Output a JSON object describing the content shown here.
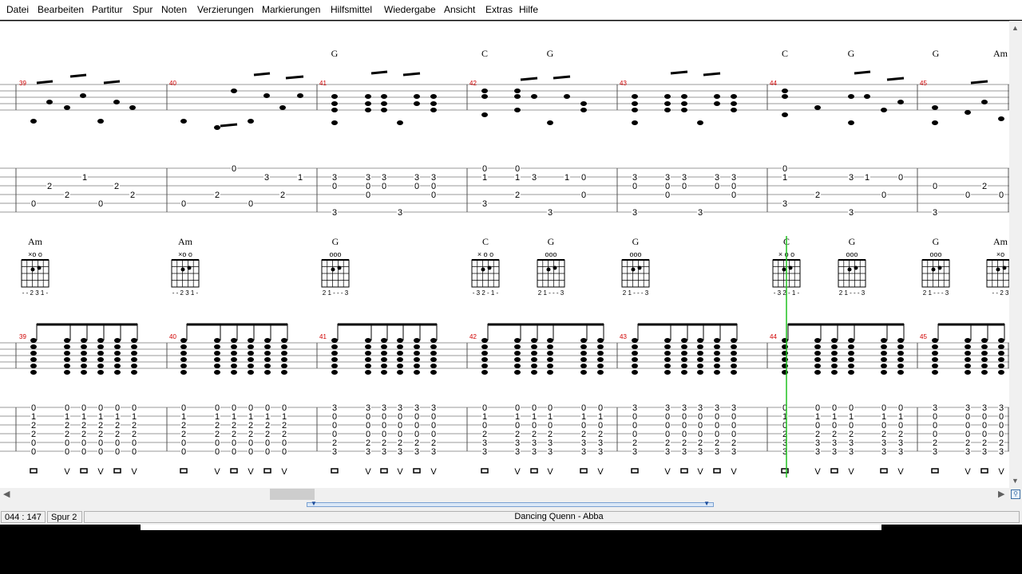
{
  "menu": [
    "Datei",
    "Bearbeiten",
    "Partitur",
    "Spur",
    "Noten",
    "Verzierungen",
    "Markierungen",
    "Hilfsmittel",
    "Wiedergabe",
    "Ansicht",
    "Extras",
    "Hilfe"
  ],
  "score": {
    "chords_top": [
      {
        "name": "G"
      },
      {
        "name": "C"
      },
      {
        "name": "G"
      },
      {
        "name": "C"
      },
      {
        "name": "G"
      },
      {
        "name": "G"
      },
      {
        "name": "Am"
      }
    ],
    "chord_diagrams": [
      {
        "name": "Am",
        "top": "×o   o",
        "fingering": "- - 2 3 1 -"
      },
      {
        "name": "Am",
        "top": "×o   o",
        "fingering": "- - 2 3 1 -"
      },
      {
        "name": "G",
        "top": "ooo",
        "fingering": "2 1 - - - 3"
      },
      {
        "name": "C",
        "top": "×  o o",
        "fingering": "- 3 2 - 1 -"
      },
      {
        "name": "G",
        "top": "ooo",
        "fingering": "2 1 - - - 3"
      },
      {
        "name": "G",
        "top": "ooo",
        "fingering": "2 1 - - - 3"
      },
      {
        "name": "C",
        "top": "×  o o",
        "fingering": "- 3 2 - 1 -"
      },
      {
        "name": "G",
        "top": "ooo",
        "fingering": "2 1 - - - 3"
      },
      {
        "name": "G",
        "top": "ooo",
        "fingering": "2 1 - - - 3"
      },
      {
        "name": "Am",
        "top": "×o",
        "fingering": "- - 2 3"
      }
    ],
    "measure_numbers": [
      "39",
      "40",
      "41",
      "42",
      "43",
      "44",
      "45"
    ],
    "tab1": [
      {
        "n": [
          [
            "0",
            42,
            5
          ],
          [
            "2",
            62,
            3
          ],
          [
            "2",
            84,
            4
          ],
          [
            "1",
            106,
            2
          ],
          [
            "0",
            126,
            5
          ],
          [
            "2",
            146,
            3
          ],
          [
            "2",
            166,
            4
          ]
        ]
      },
      {
        "n": [
          [
            "0",
            230,
            5
          ],
          [
            "2",
            272,
            4
          ],
          [
            "0",
            293,
            1
          ],
          [
            "0",
            314,
            5
          ],
          [
            "3",
            334,
            2
          ],
          [
            "2",
            354,
            4
          ],
          [
            "1",
            376,
            2
          ]
        ]
      },
      {
        "n": [
          [
            "3",
            419,
            2
          ],
          [
            "0",
            419,
            3
          ],
          [
            "3",
            419,
            6
          ],
          [
            "3",
            461,
            2
          ],
          [
            "0",
            461,
            3
          ],
          [
            "0",
            461,
            4
          ],
          [
            "3",
            481,
            2
          ],
          [
            "0",
            481,
            3
          ],
          [
            "3",
            501,
            6
          ],
          [
            "3",
            522,
            2
          ],
          [
            "0",
            522,
            3
          ],
          [
            "3",
            543,
            2
          ],
          [
            "0",
            543,
            3
          ],
          [
            "0",
            543,
            4
          ]
        ]
      },
      {
        "n": [
          [
            "0",
            607,
            1
          ],
          [
            "1",
            607,
            2
          ],
          [
            "3",
            607,
            5
          ],
          [
            "0",
            648,
            1
          ],
          [
            "1",
            648,
            2
          ],
          [
            "2",
            648,
            4
          ],
          [
            "3",
            669,
            2
          ],
          [
            "1",
            710,
            2
          ],
          [
            "3",
            689,
            6
          ],
          [
            "0",
            731,
            2
          ],
          [
            "0",
            731,
            4
          ]
        ]
      },
      {
        "n": [
          [
            "3",
            795,
            2
          ],
          [
            "0",
            795,
            3
          ],
          [
            "3",
            795,
            6
          ],
          [
            "3",
            836,
            2
          ],
          [
            "0",
            836,
            3
          ],
          [
            "0",
            836,
            4
          ],
          [
            "3",
            857,
            2
          ],
          [
            "0",
            857,
            3
          ],
          [
            "3",
            877,
            6
          ],
          [
            "3",
            898,
            2
          ],
          [
            "0",
            898,
            3
          ],
          [
            "3",
            919,
            2
          ],
          [
            "0",
            919,
            3
          ],
          [
            "0",
            919,
            4
          ]
        ]
      },
      {
        "n": [
          [
            "0",
            983,
            1
          ],
          [
            "1",
            983,
            2
          ],
          [
            "3",
            983,
            5
          ],
          [
            "2",
            1024,
            4
          ],
          [
            "3",
            1066,
            2
          ],
          [
            "3",
            1066,
            6
          ],
          [
            "1",
            1086,
            2
          ],
          [
            "0",
            1107,
            4
          ],
          [
            "0",
            1128,
            2
          ]
        ]
      },
      {
        "n": [
          [
            "0",
            1171,
            3
          ],
          [
            "3",
            1171,
            6
          ],
          [
            "0",
            1212,
            4
          ],
          [
            "2",
            1233,
            3
          ],
          [
            "0",
            1254,
            4
          ]
        ]
      }
    ],
    "tab2_groups": [
      {
        "x": [
          42,
          84,
          105,
          126,
          147,
          168
        ],
        "v": [
          "0",
          "1",
          "2",
          "2",
          "0",
          "0"
        ]
      },
      {
        "x": [
          230,
          272,
          293,
          314,
          335,
          356
        ],
        "v": [
          "0",
          "1",
          "2",
          "2",
          "0",
          "0"
        ]
      },
      {
        "x": [
          419,
          461,
          481,
          501,
          522,
          543
        ],
        "v": [
          "3",
          "0",
          "0",
          "0",
          "2",
          "3"
        ]
      },
      {
        "x": [
          607,
          648,
          669,
          689,
          731,
          752
        ],
        "v": [
          "0",
          "1",
          "0",
          "2",
          "3",
          "3"
        ]
      },
      {
        "x": [
          795,
          836,
          857,
          877,
          898,
          919
        ],
        "v": [
          "3",
          "0",
          "0",
          "0",
          "2",
          "3"
        ]
      },
      {
        "x": [
          983,
          1024,
          1045,
          1066,
          1107,
          1128
        ],
        "v": [
          "0",
          "1",
          "0",
          "2",
          "3",
          "3"
        ]
      },
      {
        "x": [
          1171,
          1212,
          1233,
          1254
        ],
        "v": [
          "3",
          "0",
          "0",
          "0",
          "2",
          "3"
        ]
      }
    ]
  },
  "status": {
    "position": "044 : 147",
    "track": "Spur 2",
    "song_title": "Dancing Quenn - Abba"
  }
}
